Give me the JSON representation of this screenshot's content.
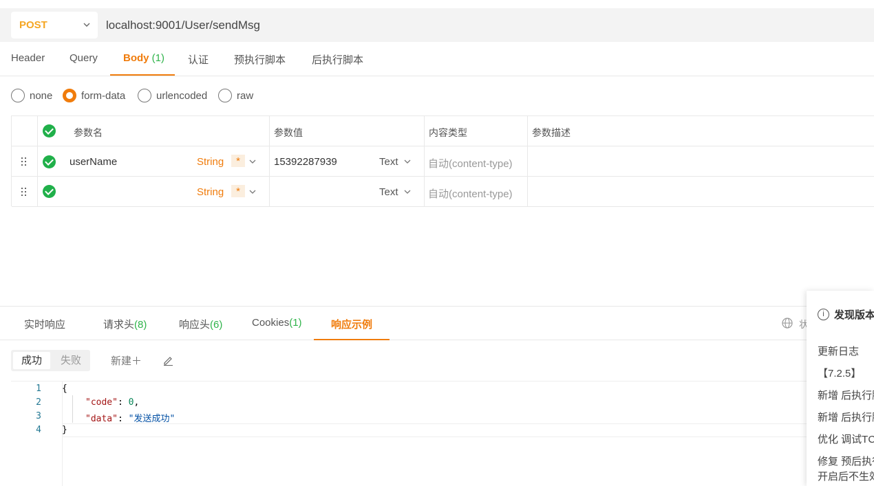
{
  "request": {
    "method": "POST",
    "url": "localhost:9001/User/sendMsg"
  },
  "req_tabs": [
    {
      "label": "Header"
    },
    {
      "label": "Query"
    },
    {
      "label": "Body",
      "count": "(1)"
    },
    {
      "label": "认证"
    },
    {
      "label": "预执行脚本"
    },
    {
      "label": "后执行脚本"
    }
  ],
  "body_types": {
    "none": "none",
    "form_data": "form-data",
    "urlencoded": "urlencoded",
    "raw": "raw",
    "selected": "form-data"
  },
  "params": {
    "headers": {
      "name": "参数名",
      "value": "参数值",
      "content_type": "内容类型",
      "description": "参数描述"
    },
    "rows": [
      {
        "name": "userName",
        "type": "String",
        "required": "*",
        "value": "15392287939",
        "value_type": "Text",
        "content_type": "自动(content-type)",
        "description": ""
      },
      {
        "name": "",
        "type": "String",
        "required": "*",
        "value": "",
        "value_type": "Text",
        "content_type": "自动(content-type)",
        "description": ""
      }
    ]
  },
  "resp_tabs": [
    {
      "label": "实时响应",
      "count": ""
    },
    {
      "label": "请求头",
      "count": "(8)"
    },
    {
      "label": "响应头",
      "count": "(6)"
    },
    {
      "label": "Cookies",
      "count": "(1)"
    },
    {
      "label": "响应示例",
      "count": ""
    }
  ],
  "resp_status_label": "状",
  "example": {
    "success": "成功",
    "fail": "失败",
    "new": "新建＋"
  },
  "code": {
    "line_numbers": [
      "1",
      "2",
      "3",
      "4"
    ],
    "open_brace": "{",
    "close_brace": "}",
    "key_code": "\"code\"",
    "val_code": "0",
    "key_data": "\"data\"",
    "val_data": "\"发送成功\""
  },
  "update_panel": {
    "title": "发现版本",
    "lines": [
      "更新日志",
      "【7.2.5】",
      "新增 后执行脚",
      "新增 后执行脚",
      "优化 调试TC",
      "修复 预后执行",
      "开启后不生效"
    ]
  },
  "colors": {
    "accent": "#f07c0c",
    "method": "#f5a623",
    "check_green": "#20b04a",
    "count_green": "#2fb34a"
  }
}
